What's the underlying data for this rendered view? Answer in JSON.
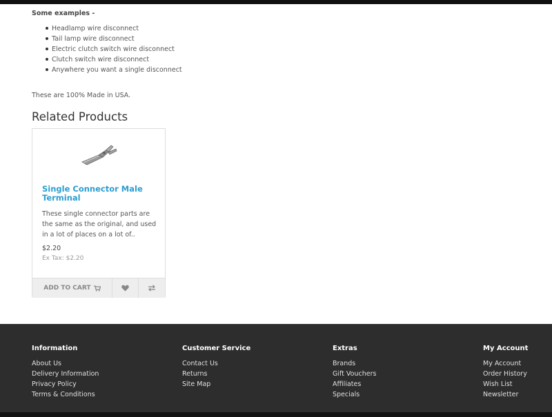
{
  "description": {
    "examples_title": "Some examples -",
    "examples": [
      "Headlamp wire disconnect",
      "Tail lamp wire disconnect",
      "Electric clutch switch wire disconnect",
      "Clutch switch wire disconnect",
      "Anywhere you want a single disconnect"
    ],
    "made_in": "These are 100% Made in USA."
  },
  "related": {
    "heading": "Related Products",
    "products": [
      {
        "name": "Single Connector Male Terminal",
        "description": "These single connector parts are the same as the original, and used in a lot of places on a lot of..",
        "price": "$2.20",
        "ex_tax": "Ex Tax: $2.20",
        "add_to_cart_label": "ADD TO CART",
        "cart_icon": "shopping-cart-icon",
        "wishlist_icon": "heart-icon",
        "compare_icon": "exchange-arrows-icon"
      }
    ]
  },
  "footer": {
    "columns": [
      {
        "title": "Information",
        "links": [
          "About Us",
          "Delivery Information",
          "Privacy Policy",
          "Terms & Conditions"
        ]
      },
      {
        "title": "Customer Service",
        "links": [
          "Contact Us",
          "Returns",
          "Site Map"
        ]
      },
      {
        "title": "Extras",
        "links": [
          "Brands",
          "Gift Vouchers",
          "Affiliates",
          "Specials"
        ]
      },
      {
        "title": "My Account",
        "links": [
          "My Account",
          "Order History",
          "Wish List",
          "Newsletter"
        ]
      }
    ]
  },
  "colors": {
    "accent": "#2a9ed0",
    "footer_bg": "#2d2d2d",
    "button_bg": "#eeeeee"
  }
}
